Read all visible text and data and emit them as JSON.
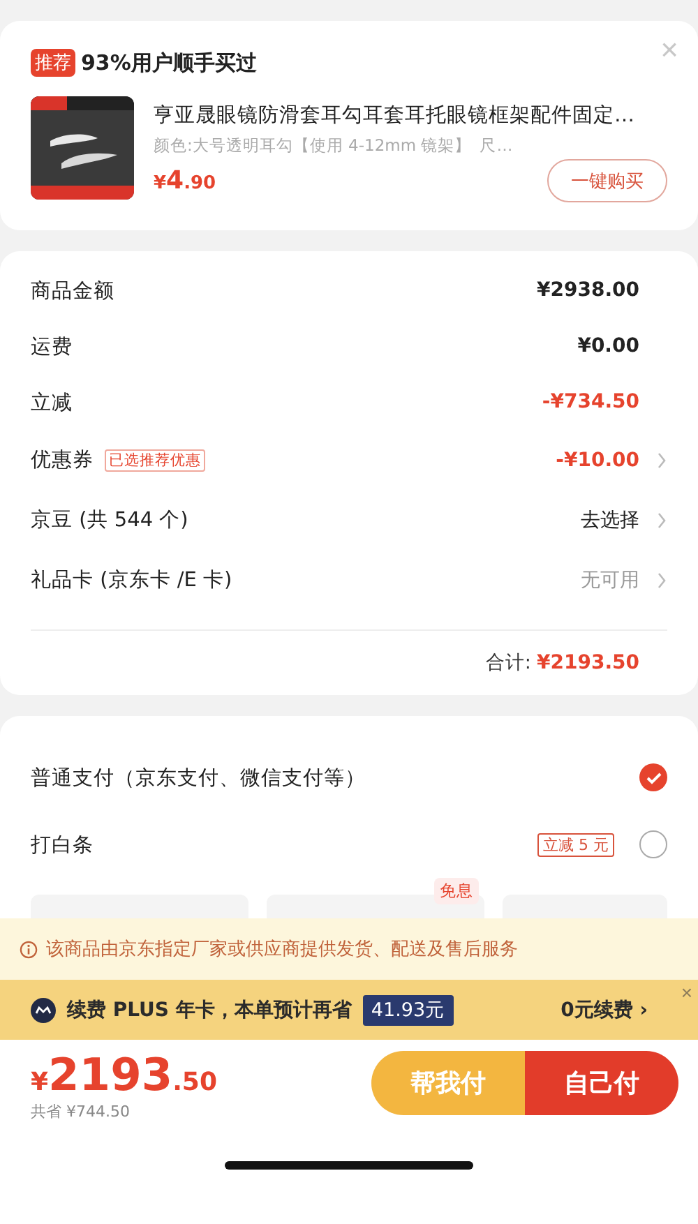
{
  "recommend": {
    "tag": "推荐",
    "title": "93%用户顺手买过",
    "close": "×",
    "product": {
      "name": "亨亚晟眼镜防滑套耳勾耳套耳托眼镜框架配件固定…",
      "spec": "颜色:大号透明耳勾【使用 4-12mm 镜架】",
      "spec_more": "尺…",
      "price_symbol": "¥",
      "price_int": "4",
      "price_dec": ".90",
      "buy": "一键购买"
    }
  },
  "summary": {
    "rows": [
      {
        "label": "商品金额",
        "value": "¥2938.00",
        "kind": "amount",
        "color": "#222222",
        "arrow": false
      },
      {
        "label": "运费",
        "value": "¥0.00",
        "kind": "amount",
        "color": "#222222",
        "arrow": false
      },
      {
        "label": "立减",
        "value": "-¥734.50",
        "kind": "amount",
        "color": "#e6432d",
        "arrow": false
      },
      {
        "label": "优惠券",
        "tag": "已选推荐优惠",
        "value": "-¥10.00",
        "kind": "amount",
        "color": "#e6432d",
        "arrow": true
      },
      {
        "label": "京豆 (共 544 个)",
        "value": "去选择",
        "kind": "option",
        "color": "#222222",
        "arrow": true
      },
      {
        "label": "礼品卡 (京东卡 /E 卡)",
        "value": "无可用",
        "kind": "option",
        "color": "#999999",
        "arrow": true
      }
    ],
    "total_label": "合计:",
    "total_value": "¥2193.50"
  },
  "payment": {
    "options": [
      {
        "label": "普通支付（京东支付、微信支付等）",
        "selected": true
      },
      {
        "label": "打白条",
        "tag": "立减 5 元",
        "selected": false
      }
    ],
    "plans": [
      {
        "kind": "plain"
      },
      {
        "kind": "badged",
        "badge": "免息"
      },
      {
        "kind": "plain"
      }
    ]
  },
  "notice": "该商品由京东指定厂家或供应商提供发货、配送及售后服务",
  "plus": {
    "text": "续费 PLUS 年卡，本单预计再省",
    "amount": "41.93元",
    "action": "0元续费",
    "arrow": "›",
    "close": "×"
  },
  "footer": {
    "symbol": "¥",
    "int": "2193",
    "dec": ".50",
    "saved": "共省 ¥744.50",
    "help": "帮我付",
    "pay": "自己付"
  }
}
